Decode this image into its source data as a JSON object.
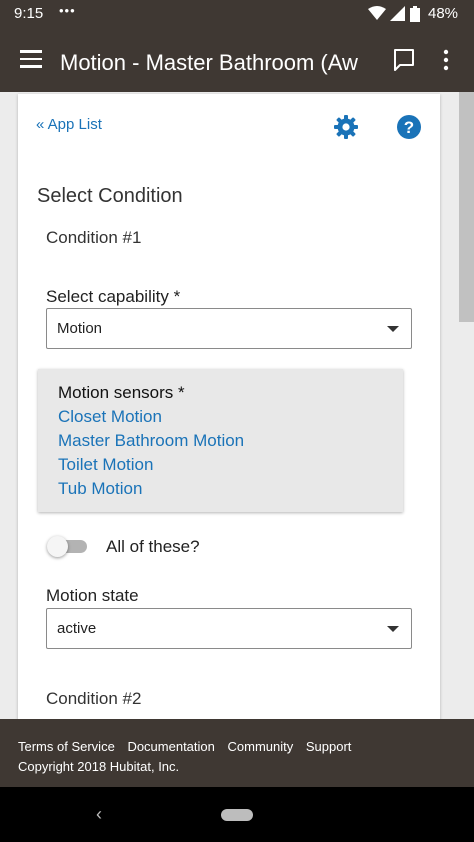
{
  "status_bar": {
    "time": "9:15",
    "dots": "•••",
    "battery_pct": "48%"
  },
  "app_bar": {
    "title": "Motion - Master Bathroom (Aw"
  },
  "nav": {
    "app_list_link": "« App List"
  },
  "section": {
    "heading": "Select Condition",
    "condition1": "Condition #1",
    "condition2": "Condition #2"
  },
  "capability": {
    "label": "Select capability *",
    "value": "Motion"
  },
  "sensors": {
    "title": "Motion sensors *",
    "items": [
      "Closet Motion",
      "Master Bathroom Motion",
      "Toilet Motion",
      "Tub Motion"
    ]
  },
  "all_toggle": {
    "label": "All of these?",
    "on": false
  },
  "motion_state": {
    "label": "Motion state",
    "value": "active"
  },
  "footer": {
    "links": [
      "Terms of Service",
      "Documentation",
      "Community",
      "Support"
    ],
    "copyright": "Copyright 2018 Hubitat, Inc."
  },
  "colors": {
    "app_bar": "#3f3833",
    "link": "#1a73b8"
  },
  "icons": [
    "menu-icon",
    "chat-icon",
    "more-vert-icon",
    "gear-icon",
    "help-icon",
    "back-icon",
    "home-pill-icon",
    "wifi-icon",
    "signal-icon",
    "battery-icon"
  ]
}
